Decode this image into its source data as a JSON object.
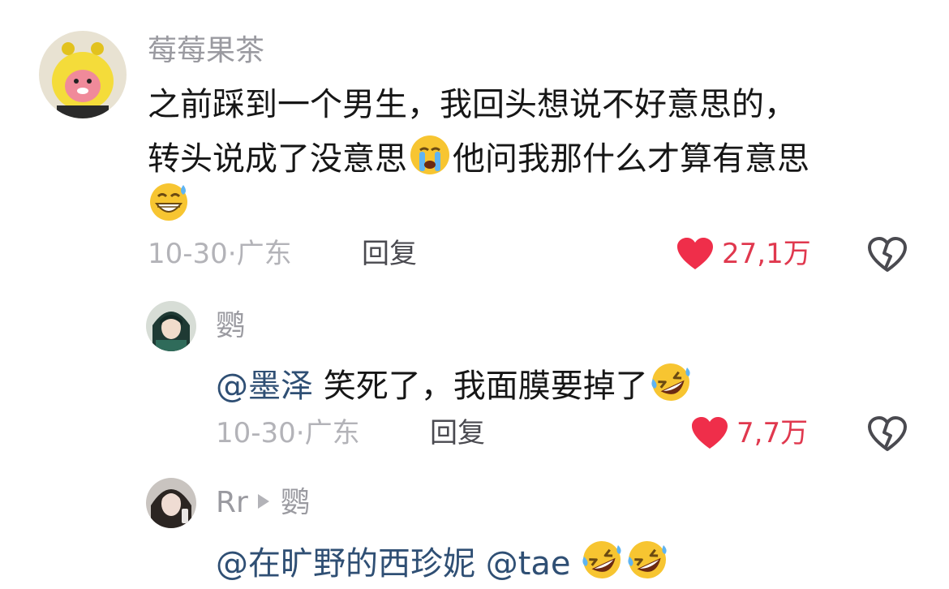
{
  "comments": [
    {
      "username": "莓莓果茶",
      "text_lines": [
        "之前踩到一个男生，我回头想说不好意思的，",
        "转头说成了没意思",
        "他问我那什么才算有意思"
      ],
      "emoji_names": [
        "crying-face-icon",
        "grinning-sweat-face-icon"
      ],
      "date": "10-30",
      "location": "广东",
      "reply_label": "回复",
      "like_count": "27,1万"
    },
    {
      "username": "鹦",
      "mention": "@墨泽",
      "text": "笑死了，我面膜要掉了",
      "emoji_names": [
        "rolling-laughing-face-icon"
      ],
      "date": "10-30",
      "location": "广东",
      "reply_label": "回复",
      "like_count": "7,7万"
    },
    {
      "username": "Rr",
      "reply_to": "鹦",
      "mention_1": "@在旷野的西珍妮",
      "mention_2": "@tae",
      "emoji_names": [
        "rolling-laughing-face-icon",
        "rolling-laughing-face-icon"
      ]
    }
  ],
  "meta_separator": "·",
  "colors": {
    "like_red": "#e0384e",
    "mention_blue": "#2f4f74",
    "muted_gray": "#b3b3b8",
    "username_gray": "#9a9aa0"
  }
}
